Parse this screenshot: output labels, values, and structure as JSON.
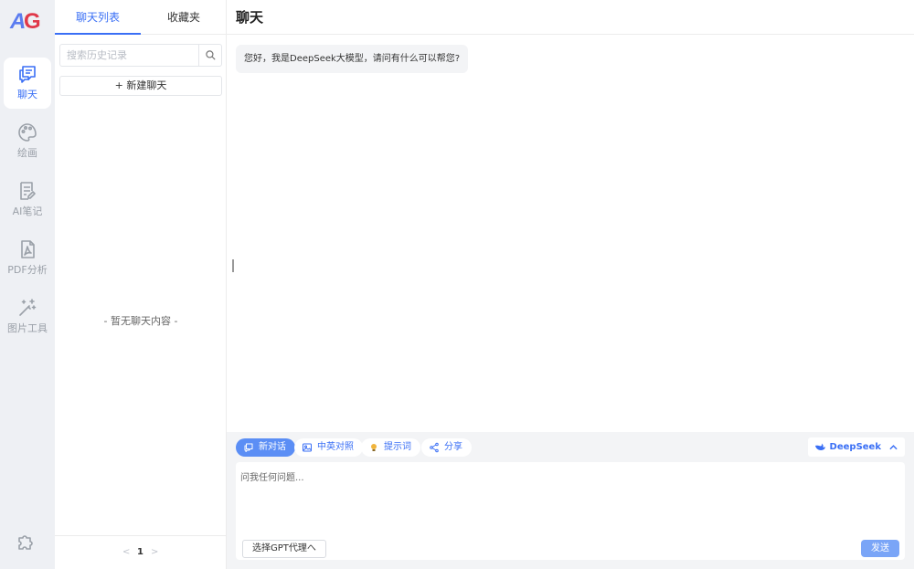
{
  "app": {
    "logo_text_a": "A",
    "logo_text_g": "G"
  },
  "nav": {
    "items": [
      {
        "label": "聊天",
        "icon": "chat-icon",
        "active": true
      },
      {
        "label": "绘画",
        "icon": "palette-icon",
        "active": false
      },
      {
        "label": "AI笔记",
        "icon": "note-icon",
        "active": false
      },
      {
        "label": "PDF分析",
        "icon": "pdf-icon",
        "active": false
      },
      {
        "label": "图片工具",
        "icon": "magic-wand-icon",
        "active": false
      }
    ],
    "bottom_icon": "puzzle-icon"
  },
  "list": {
    "tabs": [
      {
        "label": "聊天列表",
        "active": true
      },
      {
        "label": "收藏夹",
        "active": false
      }
    ],
    "search": {
      "placeholder": "搜索历史记录",
      "value": ""
    },
    "new_chat_label": "+ 新建聊天",
    "empty_text": "- 暂无聊天内容 -",
    "pager": {
      "prev": "<",
      "page": "1",
      "next": ">"
    }
  },
  "main": {
    "title": "聊天",
    "messages": [
      {
        "role": "assistant",
        "text": "您好，我是DeepSeek大模型，请问有什么可以帮您?"
      }
    ]
  },
  "composer": {
    "chips": [
      {
        "label": "新对话",
        "icon": "new-chat-icon",
        "primary": true
      },
      {
        "label": "中英对照",
        "icon": "image-icon",
        "primary": false
      },
      {
        "label": "提示词",
        "icon": "bulb-icon",
        "primary": false
      },
      {
        "label": "分享",
        "icon": "share-icon",
        "primary": false
      }
    ],
    "model_label": "DeepSeek",
    "input_placeholder": "问我任何问题...",
    "input_value": "",
    "proxy_label": "选择GPT代理へ",
    "send_label": "发送"
  },
  "colors": {
    "accent": "#3a6ff5",
    "rail_bg": "#eef0f4",
    "composer_bg": "#f3f4f6",
    "send_bg": "#7aa5f7",
    "logo_blue": "#5b7cf0",
    "logo_red": "#e0394a"
  }
}
